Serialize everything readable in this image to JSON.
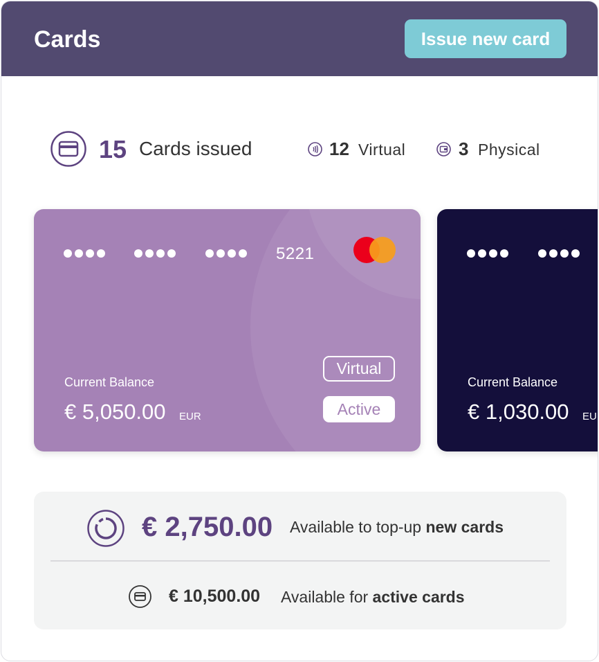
{
  "header": {
    "title": "Cards",
    "issue_button_label": "Issue new card",
    "background_color": "#524a70",
    "button_color": "#7ecbd6"
  },
  "stats": {
    "issued": {
      "count": "15",
      "label": "Cards issued",
      "icon": "credit-card-icon"
    },
    "virtual": {
      "count": "12",
      "label": "Virtual",
      "icon": "contactless-icon"
    },
    "physical": {
      "count": "3",
      "label": "Physical",
      "icon": "wallet-icon"
    }
  },
  "cards": [
    {
      "last4": "5221",
      "brand_icon": "mastercard-logo",
      "balance_label": "Current Balance",
      "balance": "€ 5,050.00",
      "currency": "EUR",
      "type_badge": "Virtual",
      "status_badge": "Active",
      "color": "#a582b6"
    },
    {
      "balance_label": "Current Balance",
      "balance": "€ 1,030.00",
      "currency": "EUR",
      "color": "#140f3b"
    }
  ],
  "summary": {
    "available_topup": {
      "amount": "€ 2,750.00",
      "text_prefix": "Available to top-up ",
      "text_bold": "new cards",
      "icon": "donut-chart-icon"
    },
    "available_active": {
      "amount": "€ 10,500.00",
      "text_prefix": "Available for ",
      "text_bold": "active cards",
      "icon": "credit-card-icon"
    }
  },
  "colors": {
    "accent": "#5d4380",
    "text": "#333333",
    "summary_bg": "#f3f4f4"
  }
}
